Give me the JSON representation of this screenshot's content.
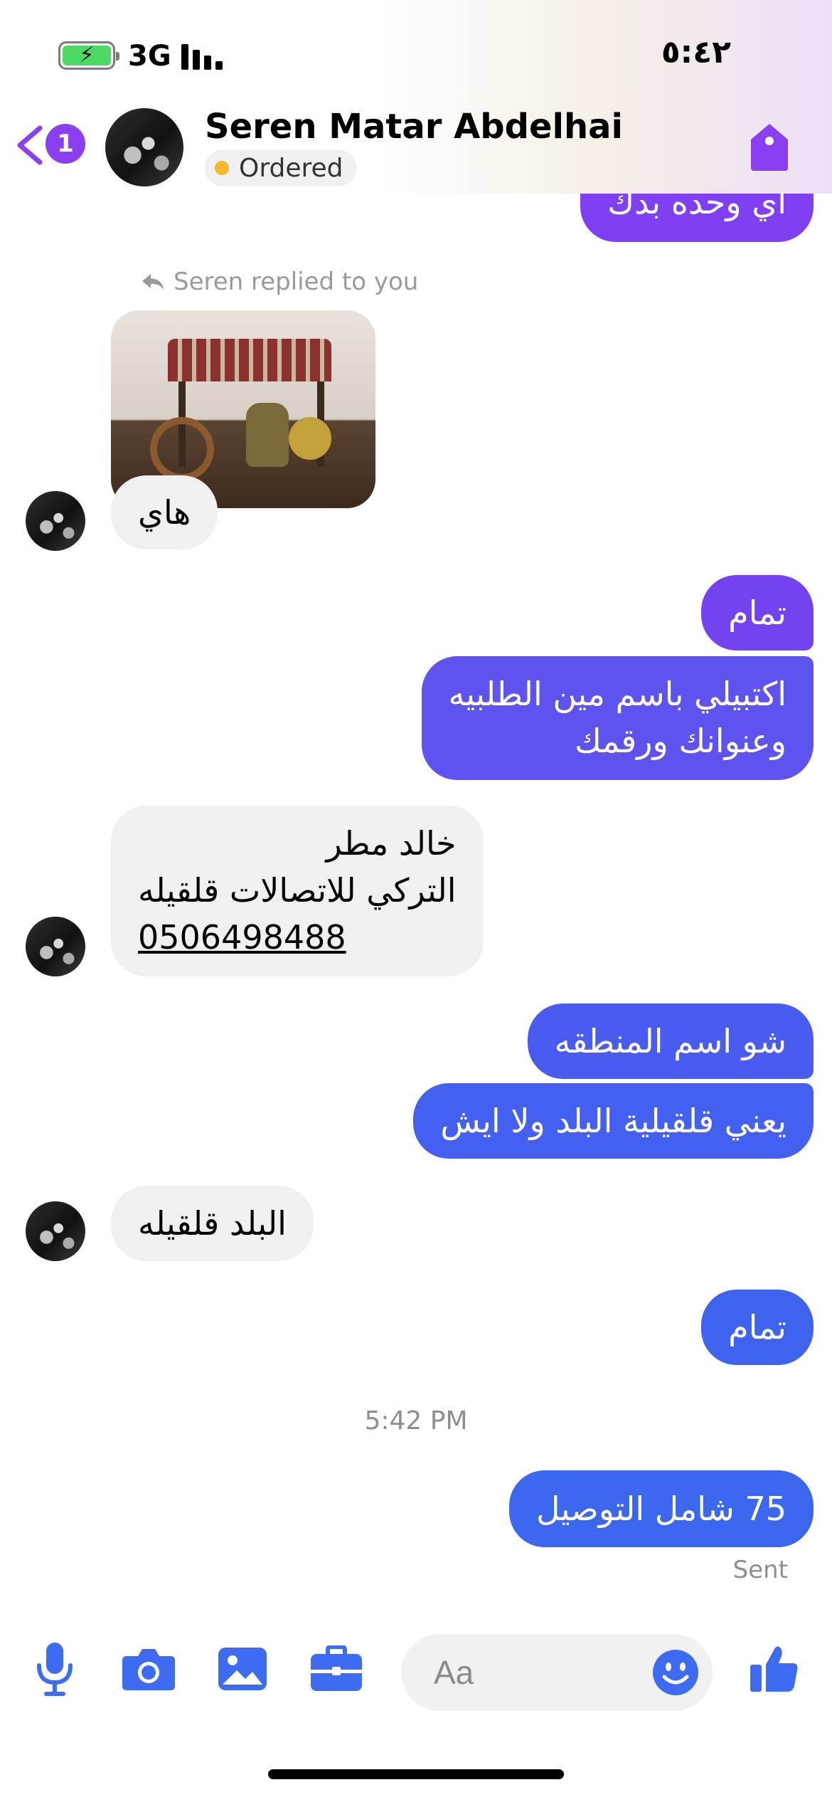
{
  "status_bar": {
    "network": "3G",
    "time": "٥:٤٢"
  },
  "header": {
    "unread_count": "1",
    "contact_name": "Seren Matar Abdelhai",
    "order_status": "Ordered"
  },
  "messages": {
    "top_partial": "اي وحده بدك",
    "reply_note": "Seren replied to you",
    "m1": "هاي",
    "m2": "تمام",
    "m3_line1": "اكتبيلي باسم مين الطلبيه",
    "m3_line2": "وعنوانك ورقمك",
    "m4_line1": "خالد مطر",
    "m4_line2": "التركي للاتصالات قلقيله",
    "m4_phone": "0506498488",
    "m5": "شو اسم المنطقه",
    "m6": "يعني قلقيلية البلد ولا ايش",
    "m7": "البلد قلقيله",
    "m8": "تمام",
    "timestamp": "5:42 PM",
    "m9": "75 شامل التوصيل",
    "sent_status": "Sent"
  },
  "composer": {
    "placeholder": "Aa"
  },
  "colors": {
    "accent_purple": "#8a3ff0",
    "bubble_purple": "#7b3ff2",
    "bubble_indigo": "#5b56ee",
    "bubble_blue": "#3b63ee",
    "icon_blue": "#3d6cf2"
  }
}
